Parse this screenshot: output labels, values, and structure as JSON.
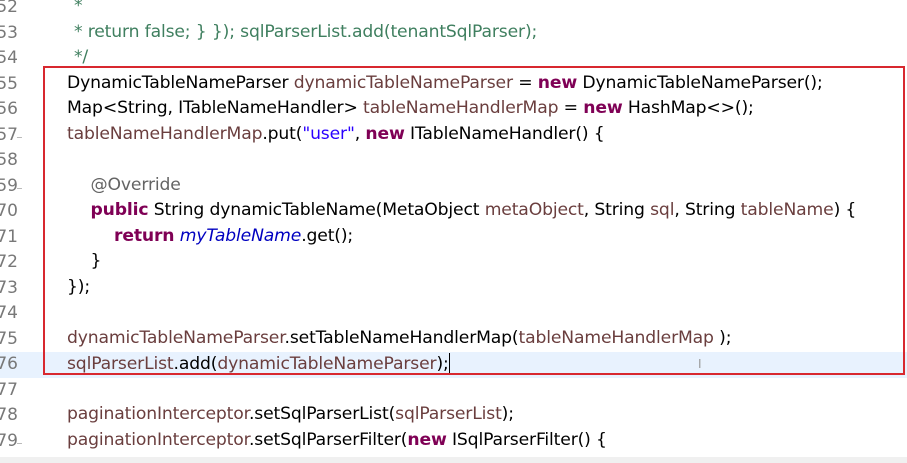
{
  "editor": {
    "cursor_glyph": "I",
    "lines": [
      {
        "n": "52",
        "indent": 0,
        "fold": false,
        "tokens": [
          {
            "t": "   *",
            "c": "cm"
          }
        ]
      },
      {
        "n": "53",
        "indent": 0,
        "fold": false,
        "tokens": [
          {
            "t": "   * return false; } }); sqlParserList.add(tenantSqlParser);",
            "c": "cm"
          }
        ]
      },
      {
        "n": "54",
        "indent": 0,
        "fold": false,
        "tokens": [
          {
            "t": "   */",
            "c": "cm"
          }
        ]
      },
      {
        "n": "55",
        "indent": 0,
        "fold": false,
        "tokens": [
          {
            "t": "DynamicTableNameParser ",
            "c": ""
          },
          {
            "t": "dynamicTableNameParser",
            "c": "fld"
          },
          {
            "t": " = ",
            "c": ""
          },
          {
            "t": "new",
            "c": "kw"
          },
          {
            "t": " DynamicTableNameParser();",
            "c": ""
          }
        ]
      },
      {
        "n": "56",
        "indent": 0,
        "fold": false,
        "tokens": [
          {
            "t": "Map<String, ITableNameHandler> ",
            "c": ""
          },
          {
            "t": "tableNameHandlerMap",
            "c": "fld"
          },
          {
            "t": " = ",
            "c": ""
          },
          {
            "t": "new",
            "c": "kw"
          },
          {
            "t": " HashMap<>();",
            "c": ""
          }
        ]
      },
      {
        "n": "57",
        "indent": 0,
        "fold": true,
        "tokens": [
          {
            "t": "tableNameHandlerMap",
            "c": "fld"
          },
          {
            "t": ".put(",
            "c": ""
          },
          {
            "t": "\"user\"",
            "c": "str"
          },
          {
            "t": ", ",
            "c": ""
          },
          {
            "t": "new",
            "c": "kw"
          },
          {
            "t": " ITableNameHandler() {",
            "c": ""
          }
        ]
      },
      {
        "n": "58",
        "indent": 0,
        "fold": false,
        "tokens": []
      },
      {
        "n": "59",
        "indent": 1,
        "fold": true,
        "tokens": [
          {
            "t": "@Override",
            "c": "ann"
          }
        ]
      },
      {
        "n": "70",
        "indent": 1,
        "fold": false,
        "tokens": [
          {
            "t": "public",
            "c": "kw"
          },
          {
            "t": " String dynamicTableName(MetaObject ",
            "c": ""
          },
          {
            "t": "metaObject",
            "c": "fld"
          },
          {
            "t": ", String ",
            "c": ""
          },
          {
            "t": "sql",
            "c": "fld"
          },
          {
            "t": ", String ",
            "c": ""
          },
          {
            "t": "tableName",
            "c": "fld"
          },
          {
            "t": ") {",
            "c": ""
          }
        ]
      },
      {
        "n": "71",
        "indent": 2,
        "fold": false,
        "tokens": [
          {
            "t": "return",
            "c": "kw"
          },
          {
            "t": " ",
            "c": ""
          },
          {
            "t": "myTableName",
            "c": "stf"
          },
          {
            "t": ".get();",
            "c": ""
          }
        ]
      },
      {
        "n": "72",
        "indent": 1,
        "fold": false,
        "tokens": [
          {
            "t": "}",
            "c": ""
          }
        ]
      },
      {
        "n": "73",
        "indent": 0,
        "fold": false,
        "tokens": [
          {
            "t": "});",
            "c": ""
          }
        ]
      },
      {
        "n": "74",
        "indent": 0,
        "fold": false,
        "tokens": []
      },
      {
        "n": "75",
        "indent": 0,
        "fold": false,
        "tokens": [
          {
            "t": "dynamicTableNameParser",
            "c": "fld"
          },
          {
            "t": ".setTableNameHandlerMap(",
            "c": ""
          },
          {
            "t": "tableNameHandlerMap",
            "c": "fld"
          },
          {
            "t": " );",
            "c": ""
          }
        ]
      },
      {
        "n": "76",
        "indent": 0,
        "fold": false,
        "current": true,
        "caret": true,
        "tokens": [
          {
            "t": "sqlParserList",
            "c": "fld"
          },
          {
            "t": ".add(",
            "c": ""
          },
          {
            "t": "dynamicTableNameParser",
            "c": "fld"
          },
          {
            "t": ");",
            "c": ""
          }
        ]
      },
      {
        "n": "77",
        "indent": 0,
        "fold": false,
        "tokens": []
      },
      {
        "n": "78",
        "indent": 0,
        "fold": false,
        "tokens": [
          {
            "t": "paginationInterceptor",
            "c": "fld"
          },
          {
            "t": ".setSqlParserList(",
            "c": ""
          },
          {
            "t": "sqlParserList",
            "c": "fld"
          },
          {
            "t": ");",
            "c": ""
          }
        ]
      },
      {
        "n": "79",
        "indent": 0,
        "fold": true,
        "tokens": [
          {
            "t": "paginationInterceptor",
            "c": "fld"
          },
          {
            "t": ".setSqlParserFilter(",
            "c": ""
          },
          {
            "t": "new",
            "c": "kw"
          },
          {
            "t": " ISqlParserFilter() {",
            "c": ""
          }
        ]
      }
    ]
  }
}
